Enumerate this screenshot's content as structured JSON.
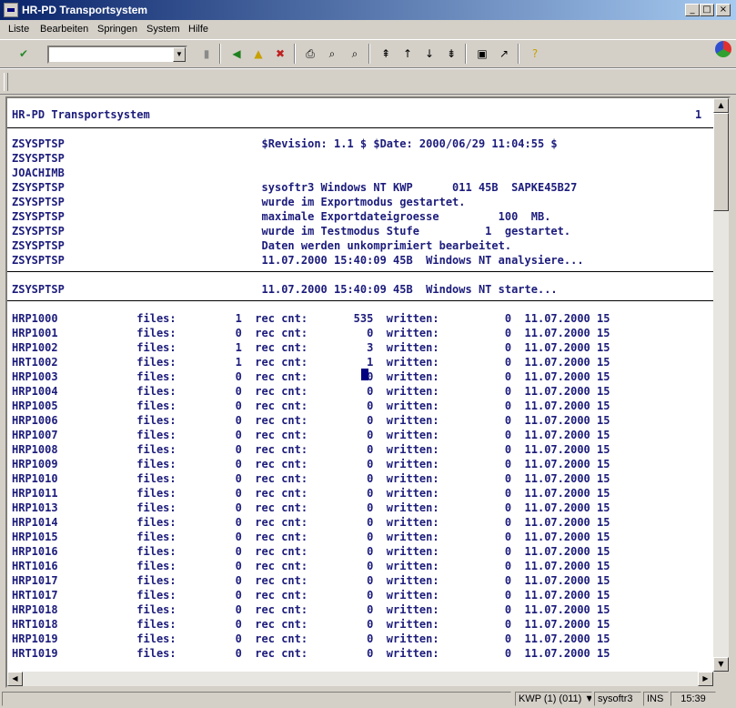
{
  "window": {
    "title": "HR-PD Transportsystem",
    "minimize_glyph": "_",
    "maximize_glyph": "□",
    "close_glyph": "×"
  },
  "menu": [
    {
      "label": "Liste"
    },
    {
      "label": "Bearbeiten"
    },
    {
      "label": "Springen"
    },
    {
      "label": "System"
    },
    {
      "label": "Hilfe"
    }
  ],
  "toolbar": {
    "command_field_value": "",
    "icons": [
      "enter-check-icon",
      "save-icon",
      "back-icon",
      "exit-icon",
      "cancel-icon",
      "print-icon",
      "find-icon",
      "find-next-icon",
      "first-page-icon",
      "previous-page-icon",
      "next-page-icon",
      "last-page-icon",
      "create-session-icon",
      "shortcut-icon",
      "help-icon"
    ]
  },
  "report": {
    "header_left": "HR-PD Transportsystem",
    "page_number": "1",
    "info_lines": [
      "ZSYSPTSP                              $Revision: 1.1 $ $Date: 2000/06/29 11:04:55 $",
      "ZSYSPTSP",
      "JOACHIMB",
      "ZSYSPTSP                              sysoftr3 Windows NT KWP      011 45B  SAPKE45B27",
      "ZSYSPTSP                              wurde im Exportmodus gestartet.",
      "ZSYSPTSP                              maximale Exportdateigroesse         100  MB.",
      "ZSYSPTSP                              wurde im Testmodus Stufe          1  gestartet.",
      "ZSYSPTSP                              Daten werden unkomprimiert bearbeitet.",
      "ZSYSPTSP                              11.07.2000 15:40:09 45B  Windows NT analysiere..."
    ],
    "start_line": "ZSYSPTSP                              11.07.2000 15:40:09 45B  Windows NT starte...",
    "table_rows": [
      "HRP1000            files:         1  rec cnt:       535  written:          0  11.07.2000 15",
      "HRP1001            files:         0  rec cnt:         0  written:          0  11.07.2000 15",
      "HRP1002            files:         1  rec cnt:         3  written:          0  11.07.2000 15",
      "HRT1002            files:         1  rec cnt:         1  written:          0  11.07.2000 15",
      "HRP1003            files:         0  rec cnt:         0  written:          0  11.07.2000 15",
      "HRP1004            files:         0  rec cnt:         0  written:          0  11.07.2000 15",
      "HRP1005            files:         0  rec cnt:         0  written:          0  11.07.2000 15",
      "HRP1006            files:         0  rec cnt:         0  written:          0  11.07.2000 15",
      "HRP1007            files:         0  rec cnt:         0  written:          0  11.07.2000 15",
      "HRP1008            files:         0  rec cnt:         0  written:          0  11.07.2000 15",
      "HRP1009            files:         0  rec cnt:         0  written:          0  11.07.2000 15",
      "HRP1010            files:         0  rec cnt:         0  written:          0  11.07.2000 15",
      "HRP1011            files:         0  rec cnt:         0  written:          0  11.07.2000 15",
      "HRP1013            files:         0  rec cnt:         0  written:          0  11.07.2000 15",
      "HRP1014            files:         0  rec cnt:         0  written:          0  11.07.2000 15",
      "HRP1015            files:         0  rec cnt:         0  written:          0  11.07.2000 15",
      "HRP1016            files:         0  rec cnt:         0  written:          0  11.07.2000 15",
      "HRT1016            files:         0  rec cnt:         0  written:          0  11.07.2000 15",
      "HRP1017            files:         0  rec cnt:         0  written:          0  11.07.2000 15",
      "HRT1017            files:         0  rec cnt:         0  written:          0  11.07.2000 15",
      "HRP1018            files:         0  rec cnt:         0  written:          0  11.07.2000 15",
      "HRT1018            files:         0  rec cnt:         0  written:          0  11.07.2000 15",
      "HRP1019            files:         0  rec cnt:         0  written:          0  11.07.2000 15",
      "HRT1019            files:         0  rec cnt:         0  written:          0  11.07.2000 15"
    ]
  },
  "status": {
    "system": "KWP (1) (011)",
    "dropdown_glyph": "▼",
    "server": "sysoftr3",
    "mode": "INS",
    "time": "15:39"
  },
  "colors": {
    "title_start": "#0a246a",
    "list_text": "#1c1c7c",
    "background": "#d4d0c8"
  }
}
